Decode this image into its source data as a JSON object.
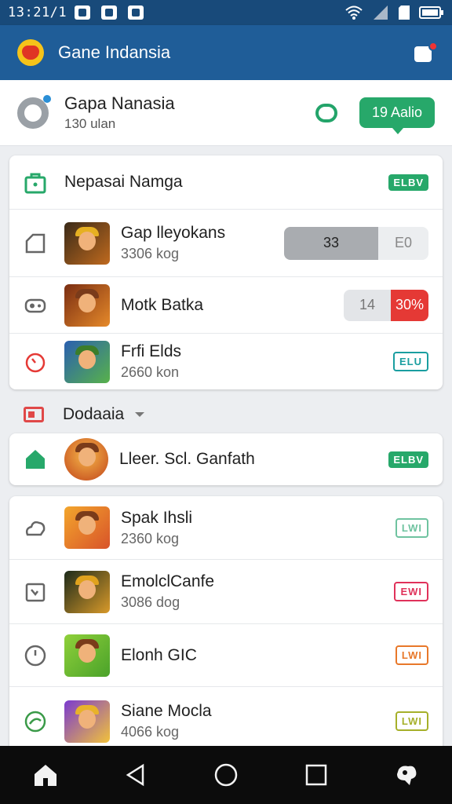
{
  "status_bar": {
    "time": "13:21/1"
  },
  "app_bar": {
    "title": "Gane Indansia"
  },
  "profile": {
    "name": "Gapa Nanasia",
    "subtitle": "130 ulan",
    "cta_label": "19 Aalio"
  },
  "card1": {
    "header": {
      "title": "Nepasai Namga",
      "badge": "ELBV"
    },
    "rows": [
      {
        "title": "Gap lleyokans",
        "subtitle": "3306 kog",
        "seg_left": "33",
        "seg_right": "E0"
      },
      {
        "title": "Motk Batka",
        "seg_left": "14",
        "seg_right": "30%"
      },
      {
        "title": "Frfi Elds",
        "subtitle": "2660 kon",
        "badge": "ELU"
      }
    ]
  },
  "section": {
    "label": "Dodaaia"
  },
  "card2": {
    "title": "Lleer. Scl. Ganfath",
    "badge": "ELBV"
  },
  "card3": {
    "rows": [
      {
        "title": "Spak Ihsli",
        "subtitle": "2360 kog",
        "badge": "LWI"
      },
      {
        "title": "EmolclCanfe",
        "subtitle": "3086 dog",
        "badge": "EWI"
      },
      {
        "title": "Elonh GIC",
        "badge": "LWI"
      },
      {
        "title": "Siane Mocla",
        "subtitle": "4066 kog",
        "badge": "LWI"
      }
    ]
  },
  "colors": {
    "accent_green": "#27a86a",
    "accent_red": "#e53935",
    "app_bar": "#1f5d98"
  },
  "icons": {
    "status": [
      "photo-icon",
      "cloud-icon",
      "flag-icon",
      "wifi-icon",
      "signal-icon",
      "battery-icon"
    ],
    "nav": [
      "home-icon",
      "back-icon",
      "circle-home-icon",
      "recents-icon",
      "assistant-icon"
    ]
  }
}
